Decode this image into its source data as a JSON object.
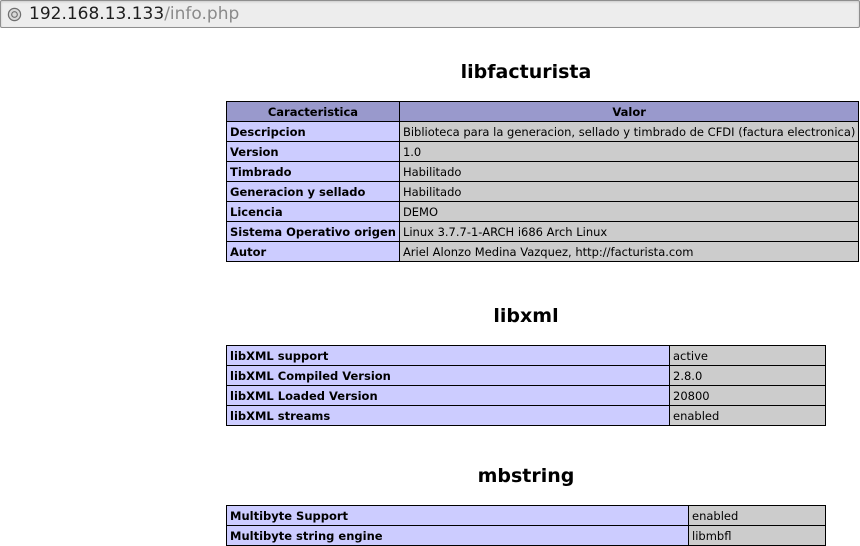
{
  "address_bar": {
    "host": "192.168.13.133",
    "path": "/info.php"
  },
  "sections": {
    "libfacturista": {
      "title": "libfacturista",
      "headers": [
        "Caracteristica",
        "Valor"
      ],
      "rows": [
        {
          "key": "Descripcion",
          "value": "Biblioteca para la generacion, sellado y timbrado de CFDI (factura electronica)"
        },
        {
          "key": "Version",
          "value": "1.0"
        },
        {
          "key": "Timbrado",
          "value": "Habilitado"
        },
        {
          "key": "Generacion y sellado",
          "value": "Habilitado"
        },
        {
          "key": "Licencia",
          "value": "DEMO"
        },
        {
          "key": "Sistema Operativo origen",
          "value": "Linux 3.7.7-1-ARCH i686 Arch Linux"
        },
        {
          "key": "Autor",
          "value": "Ariel Alonzo Medina Vazquez, http://facturista.com"
        }
      ]
    },
    "libxml": {
      "title": "libxml",
      "rows": [
        {
          "key": "libXML support",
          "value": "active"
        },
        {
          "key": "libXML Compiled Version",
          "value": "2.8.0"
        },
        {
          "key": "libXML Loaded Version",
          "value": "20800"
        },
        {
          "key": "libXML streams",
          "value": "enabled"
        }
      ]
    },
    "mbstring": {
      "title": "mbstring",
      "rows": [
        {
          "key": "Multibyte Support",
          "value": "enabled"
        },
        {
          "key": "Multibyte string engine",
          "value": "libmbfl"
        }
      ]
    }
  }
}
